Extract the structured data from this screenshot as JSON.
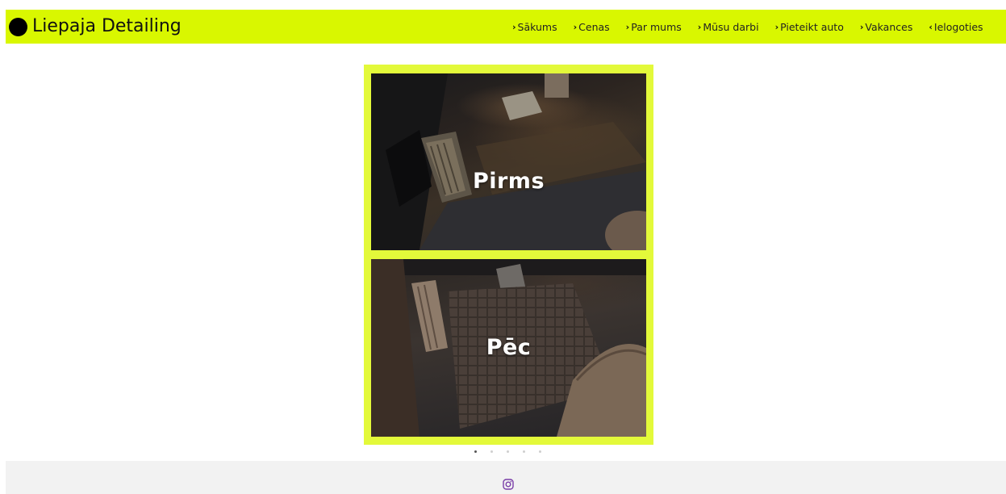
{
  "header": {
    "brand": "Liepaja Detailing",
    "background": "#d9f700",
    "nav": [
      {
        "chevron": "›",
        "label": "Sākums",
        "icon": "chevron-right-icon"
      },
      {
        "chevron": "›",
        "label": "Cenas",
        "icon": "chevron-right-icon"
      },
      {
        "chevron": "›",
        "label": "Par mums",
        "icon": "chevron-right-icon"
      },
      {
        "chevron": "›",
        "label": "Mūsu darbi",
        "icon": "chevron-right-icon"
      },
      {
        "chevron": "›",
        "label": "Pieteikt auto",
        "icon": "chevron-right-icon"
      },
      {
        "chevron": "›",
        "label": "Vakances",
        "icon": "chevron-right-icon"
      },
      {
        "chevron": "‹",
        "label": "Ielogoties",
        "icon": "chevron-left-icon"
      }
    ]
  },
  "slider": {
    "frame_color": "#e3f93a",
    "before_label": "Pirms",
    "after_label": "Pēc",
    "slide_count": 5,
    "active_slide": 1
  },
  "footer": {
    "icon": "instagram-icon",
    "icon_color": "#7a3fa8"
  }
}
